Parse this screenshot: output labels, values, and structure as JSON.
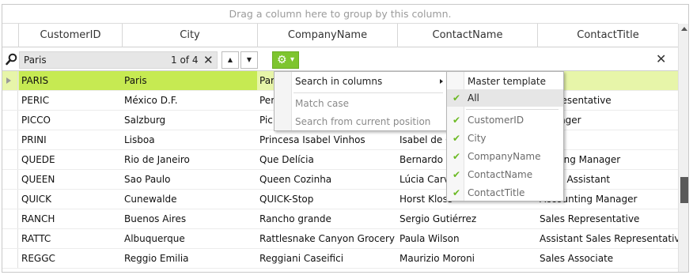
{
  "group_panel": {
    "text": "Drag a column here to group by this column."
  },
  "columns": [
    "CustomerID",
    "City",
    "CompanyName",
    "ContactName",
    "ContactTitle"
  ],
  "search": {
    "query": "Paris",
    "count": "1 of 4",
    "clear_glyph": "✕",
    "close_glyph": "✕",
    "up_glyph": "▲",
    "down_glyph": "▼",
    "gear_glyph": "⚙",
    "gear_dropdown_glyph": "▾"
  },
  "rows": [
    {
      "id": "PARIS",
      "city": "Paris",
      "company": "Par",
      "contact": "",
      "title": "er",
      "selected": true
    },
    {
      "id": "PERIC",
      "city": "México D.F.",
      "company": "Per",
      "contact": "",
      "title": "Representative"
    },
    {
      "id": "PICCO",
      "city": "Salzburg",
      "company": "Pic",
      "contact": "",
      "title": "Manager"
    },
    {
      "id": "PRINI",
      "city": "Lisboa",
      "company": "Princesa Isabel Vinhos",
      "contact": "Isabel de C",
      "title": "r"
    },
    {
      "id": "QUEDE",
      "city": "Rio de Janeiro",
      "company": "Que Delícia",
      "contact": "Bernardo B",
      "title": "ounting Manager"
    },
    {
      "id": "QUEEN",
      "city": "Sao Paulo",
      "company": "Queen Cozinha",
      "contact": "Lúcia Carva",
      "title": "eting Assistant"
    },
    {
      "id": "QUICK",
      "city": "Cunewalde",
      "company": "QUICK-Stop",
      "contact": "Horst Kloss",
      "title": "Accounting Manager"
    },
    {
      "id": "RANCH",
      "city": "Buenos Aires",
      "company": "Rancho grande",
      "contact": "Sergio Gutiérrez",
      "title": "Sales Representative"
    },
    {
      "id": "RATTC",
      "city": "Albuquerque",
      "company": "Rattlesnake Canyon Grocery",
      "contact": "Paula Wilson",
      "title": "Assistant Sales Representative"
    },
    {
      "id": "REGGC",
      "city": "Reggio Emilia",
      "company": "Reggiani Caseifici",
      "contact": "Maurizio Moroni",
      "title": "Sales Associate"
    }
  ],
  "menu": {
    "search_in_columns": "Search in columns",
    "match_case": "Match case",
    "search_from_current": "Search from current position"
  },
  "submenu": {
    "master_template": "Master template",
    "all": "All",
    "checkmark": "✔",
    "columns": [
      "CustomerID",
      "City",
      "CompanyName",
      "ContactName",
      "ContactTitle"
    ]
  },
  "colors": {
    "accent": "#7ec52e",
    "selected_row": "#e7f5a9",
    "match_highlight": "#c6ea52"
  }
}
